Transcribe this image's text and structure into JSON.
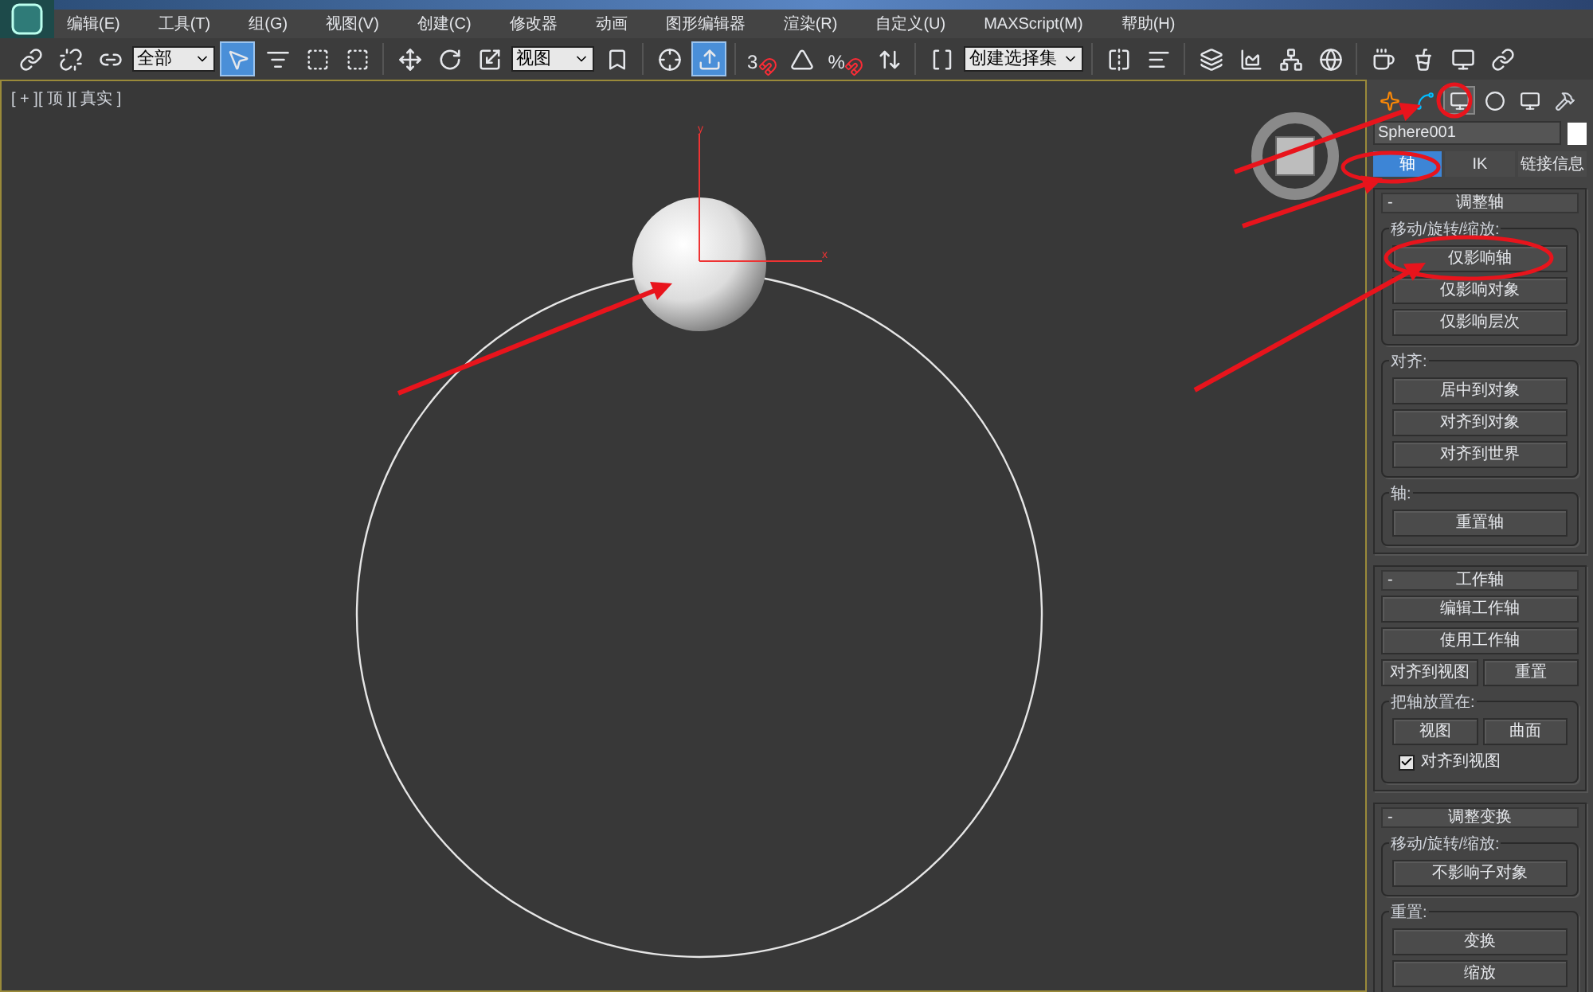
{
  "menu": [
    "编辑(E)",
    "工具(T)",
    "组(G)",
    "视图(V)",
    "创建(C)",
    "修改器",
    "动画",
    "图形编辑器",
    "渲染(R)",
    "自定义(U)",
    "MAXScript(M)",
    "帮助(H)"
  ],
  "toolbar": [
    {
      "kind": "tool",
      "selected": false
    },
    {
      "kind": "tool",
      "selected": false
    },
    {
      "kind": "tool",
      "selected": false
    },
    {
      "kind": "dropdown",
      "value": "全部"
    },
    {
      "kind": "tool",
      "selected": true
    },
    {
      "kind": "tool",
      "selected": false
    },
    {
      "kind": "tool",
      "selected": false
    },
    {
      "kind": "tool",
      "selected": false
    },
    {
      "kind": "separator"
    },
    {
      "kind": "tool",
      "selected": false
    },
    {
      "kind": "tool",
      "selected": false
    },
    {
      "kind": "tool",
      "selected": false
    },
    {
      "kind": "dropdown",
      "value": "视图"
    },
    {
      "kind": "tool",
      "selected": false
    },
    {
      "kind": "separator"
    },
    {
      "kind": "tool",
      "selected": false
    },
    {
      "kind": "tool",
      "selected": true
    },
    {
      "kind": "separator"
    },
    {
      "kind": "snap",
      "label": "3"
    },
    {
      "kind": "tool",
      "selected": false
    },
    {
      "kind": "snap",
      "label": "%"
    },
    {
      "kind": "tool",
      "selected": false
    },
    {
      "kind": "separator"
    },
    {
      "kind": "tool",
      "selected": false
    },
    {
      "kind": "dropdown",
      "value": "创建选择集"
    },
    {
      "kind": "separator"
    },
    {
      "kind": "tool",
      "selected": false
    },
    {
      "kind": "tool",
      "selected": false
    },
    {
      "kind": "separator"
    },
    {
      "kind": "tool",
      "selected": false
    },
    {
      "kind": "tool",
      "selected": false
    },
    {
      "kind": "tool",
      "selected": false
    },
    {
      "kind": "tool",
      "selected": false
    },
    {
      "kind": "separator"
    },
    {
      "kind": "tool",
      "selected": false
    },
    {
      "kind": "tool",
      "selected": false
    },
    {
      "kind": "tool",
      "selected": false
    },
    {
      "kind": "tool",
      "selected": false
    }
  ],
  "viewport": {
    "label": "[ + ][ 顶 ][ 真实 ]",
    "axis_labels": [
      "y",
      "x"
    ]
  },
  "command_panel": {
    "tabs": [
      {
        "selected": false
      },
      {
        "selected": false
      },
      {
        "selected": true
      },
      {
        "selected": false
      },
      {
        "selected": false
      },
      {
        "selected": false
      }
    ],
    "object_name": "Sphere001",
    "subtabs": [
      {
        "label": "轴",
        "selected": true
      },
      {
        "label": "IK",
        "selected": false
      },
      {
        "label": "链接信息",
        "selected": false
      }
    ],
    "rollouts": [
      {
        "title": "调整轴",
        "toggle": "-",
        "items": [
          {
            "kind": "group",
            "label": "移动/旋转/缩放:",
            "items": [
              {
                "kind": "button",
                "label": "仅影响轴"
              },
              {
                "kind": "button",
                "label": "仅影响对象"
              },
              {
                "kind": "button",
                "label": "仅影响层次"
              }
            ]
          },
          {
            "kind": "group",
            "label": "对齐:",
            "items": [
              {
                "kind": "button",
                "label": "居中到对象"
              },
              {
                "kind": "button",
                "label": "对齐到对象"
              },
              {
                "kind": "button",
                "label": "对齐到世界"
              }
            ]
          },
          {
            "kind": "group",
            "label": "轴:",
            "items": [
              {
                "kind": "button",
                "label": "重置轴"
              }
            ]
          }
        ]
      },
      {
        "title": "工作轴",
        "toggle": "-",
        "items": [
          {
            "kind": "button",
            "label": "编辑工作轴"
          },
          {
            "kind": "button",
            "label": "使用工作轴"
          },
          {
            "kind": "row",
            "items": [
              {
                "kind": "button",
                "label": "对齐到视图"
              },
              {
                "kind": "button",
                "label": "重置"
              }
            ]
          },
          {
            "kind": "group",
            "label": "把轴放置在:",
            "items": [
              {
                "kind": "row",
                "items": [
                  {
                    "kind": "button",
                    "label": "视图"
                  },
                  {
                    "kind": "button",
                    "label": "曲面"
                  }
                ]
              },
              {
                "kind": "checkbox",
                "label": "对齐到视图",
                "checked": true
              }
            ]
          }
        ]
      },
      {
        "title": "调整变换",
        "toggle": "-",
        "items": [
          {
            "kind": "group",
            "label": "移动/旋转/缩放:",
            "items": [
              {
                "kind": "button",
                "label": "不影响子对象"
              }
            ]
          },
          {
            "kind": "group",
            "label": "重置:",
            "items": [
              {
                "kind": "button",
                "label": "变换"
              },
              {
                "kind": "button",
                "label": "缩放"
              }
            ]
          }
        ]
      }
    ]
  }
}
